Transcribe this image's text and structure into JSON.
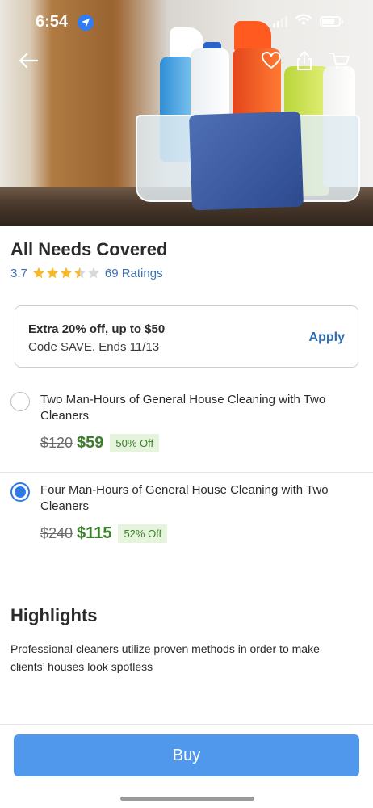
{
  "status_bar": {
    "time": "6:54",
    "icons": [
      "location-arrow-icon",
      "signal-icon",
      "wifi-icon",
      "battery-icon"
    ]
  },
  "nav": {
    "icons": [
      "back-arrow-icon",
      "heart-icon",
      "share-icon",
      "cart-icon"
    ]
  },
  "deal": {
    "title": "All Needs Covered",
    "rating_value": "3.7",
    "rating_stars": 3.5,
    "ratings_label": "69 Ratings"
  },
  "promo": {
    "title": "Extra 20% off, up to $50",
    "subtitle": "Code SAVE. Ends 11/13",
    "apply_label": "Apply"
  },
  "options": [
    {
      "title": "Two Man-Hours of General House Cleaning with Two Cleaners",
      "old_price": "$120",
      "new_price": "$59",
      "discount": "50% Off",
      "selected": false
    },
    {
      "title": "Four Man-Hours of General House Cleaning with Two Cleaners",
      "old_price": "$240",
      "new_price": "$115",
      "discount": "52% Off",
      "selected": true
    }
  ],
  "highlights": {
    "heading": "Highlights",
    "text": "Professional cleaners utilize proven methods in order to make clients’ houses look spotless"
  },
  "buy_label": "Buy",
  "colors": {
    "accent_blue": "#4f98ec",
    "link_blue": "#3a6fb3",
    "price_green": "#3a7f2a",
    "discount_bg": "#e6f4de",
    "star_gold": "#f5b72b"
  }
}
